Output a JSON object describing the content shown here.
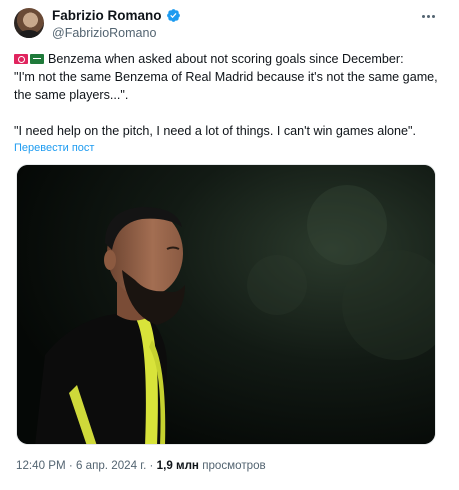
{
  "author": {
    "name": "Fabrizio Romano",
    "handle": "@FabrizioRomano"
  },
  "tweet": {
    "line1": "Benzema when asked about not scoring goals since December:",
    "line2": "\"I'm not the same Benzema of Real Madrid because it's not the same game, the same players...\".",
    "line3": "\"I need help on the pitch, I need a lot of things. I can't win games alone\".",
    "flags": [
      "flag-icon",
      "saudi-flag-icon"
    ]
  },
  "translate_label": "Перевести пост",
  "meta": {
    "time": "12:40 PM",
    "date": "6 апр. 2024 г.",
    "separator": "·",
    "views_count": "1,9 млн",
    "views_label": "просмотров"
  },
  "colors": {
    "link": "#1d9bf0",
    "verified": "#1d9bf0",
    "kit_yellow": "#d8e33a"
  }
}
